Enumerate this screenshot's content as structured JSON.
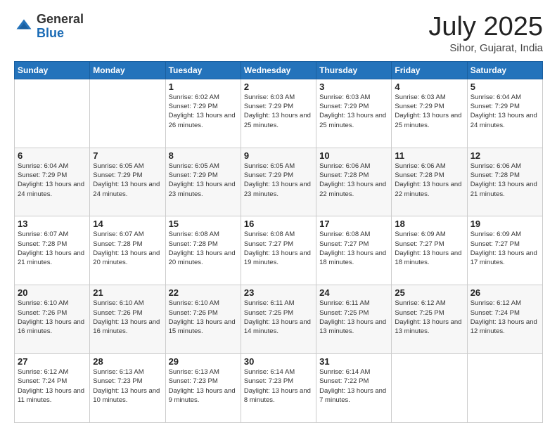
{
  "header": {
    "logo_general": "General",
    "logo_blue": "Blue",
    "month": "July 2025",
    "location": "Sihor, Gujarat, India"
  },
  "weekdays": [
    "Sunday",
    "Monday",
    "Tuesday",
    "Wednesday",
    "Thursday",
    "Friday",
    "Saturday"
  ],
  "rows": [
    [
      {
        "day": "",
        "sunrise": "",
        "sunset": "",
        "daylight": ""
      },
      {
        "day": "",
        "sunrise": "",
        "sunset": "",
        "daylight": ""
      },
      {
        "day": "1",
        "sunrise": "Sunrise: 6:02 AM",
        "sunset": "Sunset: 7:29 PM",
        "daylight": "Daylight: 13 hours and 26 minutes."
      },
      {
        "day": "2",
        "sunrise": "Sunrise: 6:03 AM",
        "sunset": "Sunset: 7:29 PM",
        "daylight": "Daylight: 13 hours and 25 minutes."
      },
      {
        "day": "3",
        "sunrise": "Sunrise: 6:03 AM",
        "sunset": "Sunset: 7:29 PM",
        "daylight": "Daylight: 13 hours and 25 minutes."
      },
      {
        "day": "4",
        "sunrise": "Sunrise: 6:03 AM",
        "sunset": "Sunset: 7:29 PM",
        "daylight": "Daylight: 13 hours and 25 minutes."
      },
      {
        "day": "5",
        "sunrise": "Sunrise: 6:04 AM",
        "sunset": "Sunset: 7:29 PM",
        "daylight": "Daylight: 13 hours and 24 minutes."
      }
    ],
    [
      {
        "day": "6",
        "sunrise": "Sunrise: 6:04 AM",
        "sunset": "Sunset: 7:29 PM",
        "daylight": "Daylight: 13 hours and 24 minutes."
      },
      {
        "day": "7",
        "sunrise": "Sunrise: 6:05 AM",
        "sunset": "Sunset: 7:29 PM",
        "daylight": "Daylight: 13 hours and 24 minutes."
      },
      {
        "day": "8",
        "sunrise": "Sunrise: 6:05 AM",
        "sunset": "Sunset: 7:29 PM",
        "daylight": "Daylight: 13 hours and 23 minutes."
      },
      {
        "day": "9",
        "sunrise": "Sunrise: 6:05 AM",
        "sunset": "Sunset: 7:29 PM",
        "daylight": "Daylight: 13 hours and 23 minutes."
      },
      {
        "day": "10",
        "sunrise": "Sunrise: 6:06 AM",
        "sunset": "Sunset: 7:28 PM",
        "daylight": "Daylight: 13 hours and 22 minutes."
      },
      {
        "day": "11",
        "sunrise": "Sunrise: 6:06 AM",
        "sunset": "Sunset: 7:28 PM",
        "daylight": "Daylight: 13 hours and 22 minutes."
      },
      {
        "day": "12",
        "sunrise": "Sunrise: 6:06 AM",
        "sunset": "Sunset: 7:28 PM",
        "daylight": "Daylight: 13 hours and 21 minutes."
      }
    ],
    [
      {
        "day": "13",
        "sunrise": "Sunrise: 6:07 AM",
        "sunset": "Sunset: 7:28 PM",
        "daylight": "Daylight: 13 hours and 21 minutes."
      },
      {
        "day": "14",
        "sunrise": "Sunrise: 6:07 AM",
        "sunset": "Sunset: 7:28 PM",
        "daylight": "Daylight: 13 hours and 20 minutes."
      },
      {
        "day": "15",
        "sunrise": "Sunrise: 6:08 AM",
        "sunset": "Sunset: 7:28 PM",
        "daylight": "Daylight: 13 hours and 20 minutes."
      },
      {
        "day": "16",
        "sunrise": "Sunrise: 6:08 AM",
        "sunset": "Sunset: 7:27 PM",
        "daylight": "Daylight: 13 hours and 19 minutes."
      },
      {
        "day": "17",
        "sunrise": "Sunrise: 6:08 AM",
        "sunset": "Sunset: 7:27 PM",
        "daylight": "Daylight: 13 hours and 18 minutes."
      },
      {
        "day": "18",
        "sunrise": "Sunrise: 6:09 AM",
        "sunset": "Sunset: 7:27 PM",
        "daylight": "Daylight: 13 hours and 18 minutes."
      },
      {
        "day": "19",
        "sunrise": "Sunrise: 6:09 AM",
        "sunset": "Sunset: 7:27 PM",
        "daylight": "Daylight: 13 hours and 17 minutes."
      }
    ],
    [
      {
        "day": "20",
        "sunrise": "Sunrise: 6:10 AM",
        "sunset": "Sunset: 7:26 PM",
        "daylight": "Daylight: 13 hours and 16 minutes."
      },
      {
        "day": "21",
        "sunrise": "Sunrise: 6:10 AM",
        "sunset": "Sunset: 7:26 PM",
        "daylight": "Daylight: 13 hours and 16 minutes."
      },
      {
        "day": "22",
        "sunrise": "Sunrise: 6:10 AM",
        "sunset": "Sunset: 7:26 PM",
        "daylight": "Daylight: 13 hours and 15 minutes."
      },
      {
        "day": "23",
        "sunrise": "Sunrise: 6:11 AM",
        "sunset": "Sunset: 7:25 PM",
        "daylight": "Daylight: 13 hours and 14 minutes."
      },
      {
        "day": "24",
        "sunrise": "Sunrise: 6:11 AM",
        "sunset": "Sunset: 7:25 PM",
        "daylight": "Daylight: 13 hours and 13 minutes."
      },
      {
        "day": "25",
        "sunrise": "Sunrise: 6:12 AM",
        "sunset": "Sunset: 7:25 PM",
        "daylight": "Daylight: 13 hours and 13 minutes."
      },
      {
        "day": "26",
        "sunrise": "Sunrise: 6:12 AM",
        "sunset": "Sunset: 7:24 PM",
        "daylight": "Daylight: 13 hours and 12 minutes."
      }
    ],
    [
      {
        "day": "27",
        "sunrise": "Sunrise: 6:12 AM",
        "sunset": "Sunset: 7:24 PM",
        "daylight": "Daylight: 13 hours and 11 minutes."
      },
      {
        "day": "28",
        "sunrise": "Sunrise: 6:13 AM",
        "sunset": "Sunset: 7:23 PM",
        "daylight": "Daylight: 13 hours and 10 minutes."
      },
      {
        "day": "29",
        "sunrise": "Sunrise: 6:13 AM",
        "sunset": "Sunset: 7:23 PM",
        "daylight": "Daylight: 13 hours and 9 minutes."
      },
      {
        "day": "30",
        "sunrise": "Sunrise: 6:14 AM",
        "sunset": "Sunset: 7:23 PM",
        "daylight": "Daylight: 13 hours and 8 minutes."
      },
      {
        "day": "31",
        "sunrise": "Sunrise: 6:14 AM",
        "sunset": "Sunset: 7:22 PM",
        "daylight": "Daylight: 13 hours and 7 minutes."
      },
      {
        "day": "",
        "sunrise": "",
        "sunset": "",
        "daylight": ""
      },
      {
        "day": "",
        "sunrise": "",
        "sunset": "",
        "daylight": ""
      }
    ]
  ]
}
